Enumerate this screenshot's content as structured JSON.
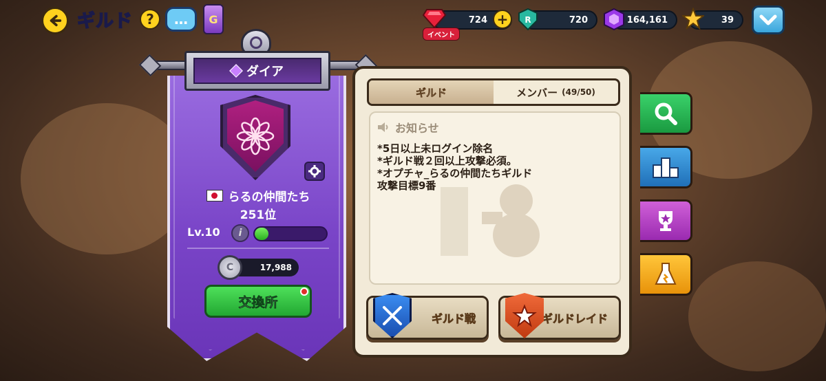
{
  "topbar": {
    "title": "ギルド",
    "help_label": "?",
    "chat_label": "…",
    "can_label": "G"
  },
  "currencies": {
    "gems": "724",
    "event_label": "イベント",
    "green": "720",
    "purple": "164,161",
    "gold": "39"
  },
  "guild": {
    "tier": "ダイア",
    "name": "らるの仲間たち",
    "rank": "251位",
    "level": "Lv.10",
    "xp_fraction": 0.1,
    "coins": "17,988",
    "coin_label": "C",
    "exchange_label": "交換所"
  },
  "tabs": {
    "guild": "ギルド",
    "member": "メンバー",
    "member_count": "(49/50)"
  },
  "notice": {
    "title": "お知らせ",
    "body": "*5日以上未ログイン除名\n*ギルド戦２回以上攻撃必須。\n*オプチャ_らるの仲間たちギルド\n攻撃目標9番"
  },
  "actions": {
    "war": "ギルド戦",
    "raid": "ギルドレイド"
  },
  "colors": {
    "banner_purple": "#7a45c8",
    "panel_bg": "#f2ead8",
    "exchange_green": "#22a832",
    "accent_yellow": "#ffd21e"
  },
  "icons": {
    "back": "back-arrow-icon",
    "search": "search-icon",
    "ranking": "podium-icon",
    "trophy": "trophy-icon",
    "lab": "flask-icon",
    "settings": "gear-icon"
  }
}
